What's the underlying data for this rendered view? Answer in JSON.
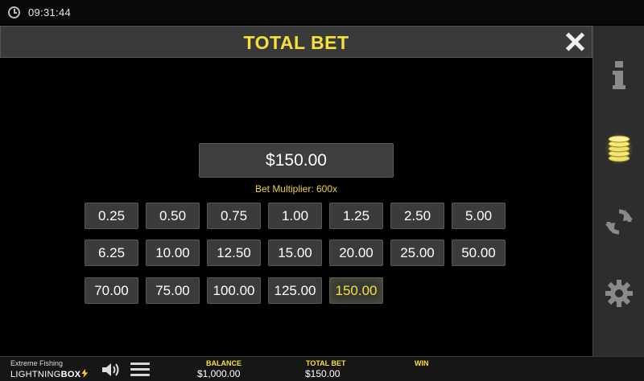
{
  "status_bar": {
    "time": "09:31:44",
    "icon": "clock-icon"
  },
  "panel": {
    "title": "TOTAL BET",
    "close_icon": "close-icon"
  },
  "bet": {
    "current_value": "$150.00",
    "multiplier_text": "Bet Multiplier: 600x",
    "options": [
      [
        "0.25",
        "0.50",
        "0.75",
        "1.00",
        "1.25",
        "2.50",
        "5.00"
      ],
      [
        "6.25",
        "10.00",
        "12.50",
        "15.00",
        "20.00",
        "25.00",
        "50.00"
      ],
      [
        "70.00",
        "75.00",
        "100.00",
        "125.00",
        "150.00"
      ]
    ],
    "selected": "150.00"
  },
  "sidebar": {
    "icons": [
      "info-icon",
      "coins-icon",
      "refresh-icon",
      "gear-icon"
    ]
  },
  "footer": {
    "game_name": "Extreme Fishing",
    "brand_main": "LIGHTNING",
    "brand_accent": "BOX",
    "balance_label": "BALANCE",
    "balance_value": "$1,000.00",
    "total_bet_label": "TOTAL BET",
    "total_bet_value": "$150.00",
    "win_label": "WIN",
    "win_value": ""
  },
  "colors": {
    "accent": "#f5e13a",
    "header_bg": "#3a3a3a",
    "button_bg": "#3b3b3b",
    "sidebar_bg": "#2d2d2d"
  }
}
